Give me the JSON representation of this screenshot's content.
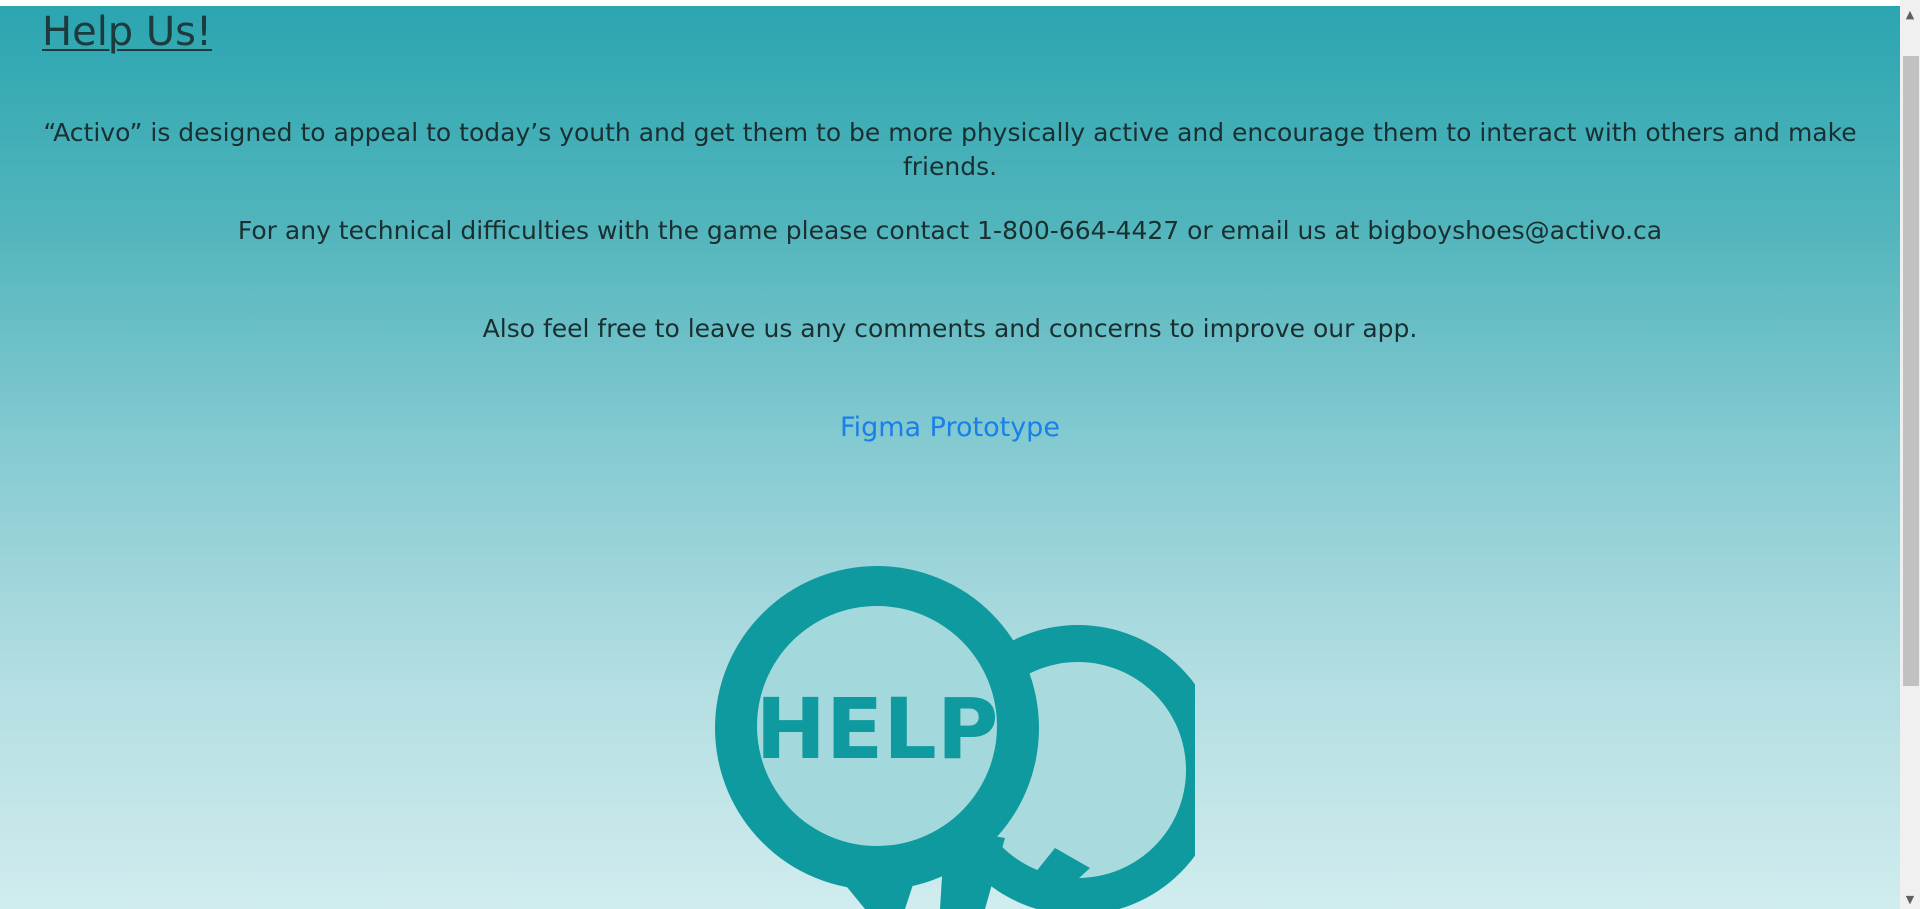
{
  "page": {
    "title": "Help Us!",
    "paragraphs": [
      "“Activo” is designed to appeal to today’s youth and get them to be more physically active and encourage them to interact with others and make friends.",
      "For any technical difficulties with the game please contact 1-800-664-4427 or email us at bigboyshoes@activo.ca",
      "Also feel free to leave us any comments and concerns to improve our app."
    ],
    "link_label": "Figma Prototype"
  },
  "graphic": {
    "icon": "help-speech-bubbles-icon",
    "label": "HELP"
  },
  "colors": {
    "gradient_top": "#2aa5b0",
    "gradient_bottom": "#d0ecee",
    "link": "#1a7fe8",
    "icon_teal": "#0e9a9e",
    "text": "#1a2f31"
  },
  "scrollbar": {
    "up_arrow": "chevron-up-icon",
    "down_arrow": "chevron-down-icon"
  }
}
